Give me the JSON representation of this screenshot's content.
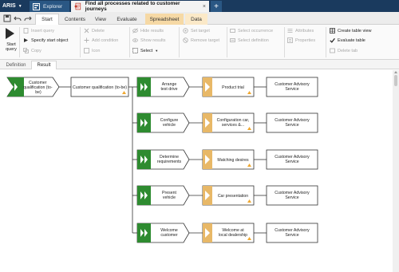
{
  "titlebar": {
    "app": "ARIS",
    "explorer_tab": "Explorer",
    "active_tab": "Find all processes related to customer journeys",
    "close_symbol": "×",
    "add_symbol": "+"
  },
  "ribbon_tabs": [
    "Start",
    "Contents",
    "View",
    "Evaluate",
    "Spreadsheet",
    "Data"
  ],
  "ribbon": {
    "start_query": "Start query",
    "group1": [
      "Insert query",
      "Specify start object",
      "Copy"
    ],
    "group2": [
      "Delete",
      "Add condition",
      "Icon"
    ],
    "group3": [
      "Hide results",
      "Show results",
      "Select"
    ],
    "group4": [
      "Set target",
      "Remove target"
    ],
    "group5": [
      "Select occurrence",
      "Select definition"
    ],
    "group6": [
      "Attributes",
      "Properties"
    ],
    "group7": [
      "Create table view",
      "Evaluate table",
      "Delete tab"
    ]
  },
  "sub_tabs": [
    "Definition",
    "Result"
  ],
  "diagram": {
    "start_event": "Customer qualification (to-be)",
    "start_process": "Customer qualification (to-be)",
    "rows": [
      {
        "event": "Arrange test drive",
        "process": "Product trial",
        "service": "Customer Advisory Service"
      },
      {
        "event": "Configure vehicle",
        "process": "Configuration car, services &...",
        "service": "Customer Advisory Service"
      },
      {
        "event": "Determine requirements",
        "process": "Matching desires",
        "service": "Customer Advisory Service"
      },
      {
        "event": "Present vehicle",
        "process": "Car presentation",
        "service": "Customer Advisory Service"
      },
      {
        "event": "Welcome customer",
        "process": "Welcome at local dealership",
        "service": "Customer Advisory Service"
      }
    ]
  },
  "colors": {
    "titlebar": "#1a3a5e",
    "green": "#2e8b30",
    "orange": "#e8b867",
    "warning": "#f0a830"
  }
}
